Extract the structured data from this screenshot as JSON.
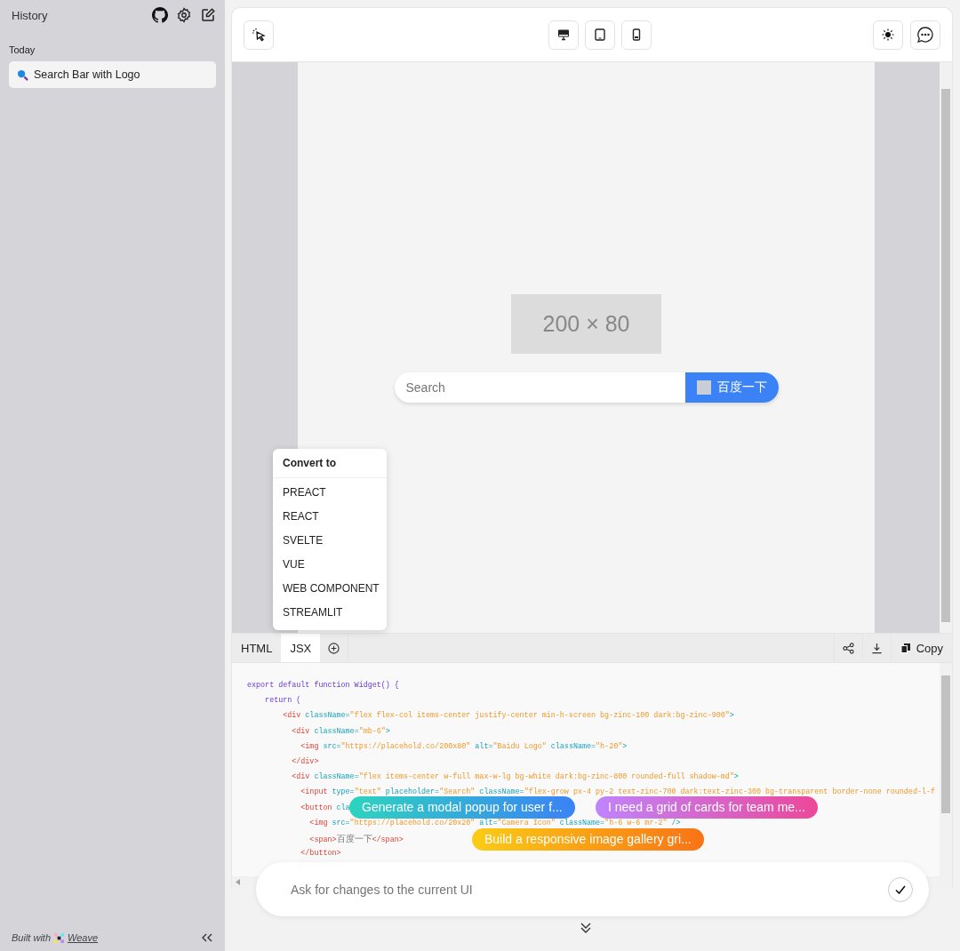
{
  "sidebar": {
    "title": "History",
    "section": "Today",
    "items": [
      {
        "label": "Search Bar with Logo",
        "selected": true
      }
    ],
    "footer": {
      "prefix": "Built with",
      "link": "Weave"
    }
  },
  "preview": {
    "logo": "200 × 80",
    "search_placeholder": "Search",
    "search_button": "百度一下"
  },
  "convert_menu": {
    "title": "Convert to",
    "options": [
      "PREACT",
      "REACT",
      "SVELTE",
      "VUE",
      "WEB COMPONENT",
      "STREAMLIT"
    ]
  },
  "code_tabs": [
    {
      "label": "HTML",
      "selected": false
    },
    {
      "label": "JSX",
      "selected": true
    }
  ],
  "copy_button": "Copy",
  "code_lines": [
    [
      {
        "kind": "kw",
        "text": "export default function Widget() {"
      }
    ],
    [
      {
        "kind": "kw",
        "text": "    return ("
      }
    ],
    [
      {
        "kind": "tag",
        "text": "        <div"
      },
      {
        "kind": "attr",
        "text": " className="
      },
      {
        "kind": "str",
        "text": "\"flex flex-col items-center justify-center min-h-screen bg-zinc-100 dark:bg-zinc-900\""
      },
      {
        "kind": "attr",
        "text": ">"
      }
    ],
    [
      {
        "kind": "tag",
        "text": "          <div"
      },
      {
        "kind": "attr",
        "text": " className="
      },
      {
        "kind": "str",
        "text": "\"mb-6\""
      },
      {
        "kind": "attr",
        "text": ">"
      }
    ],
    [
      {
        "kind": "tag",
        "text": "            <img"
      },
      {
        "kind": "attr",
        "text": " src="
      },
      {
        "kind": "str",
        "text": "\"https://placehold.co/200x80\""
      },
      {
        "kind": "attr",
        "text": " alt="
      },
      {
        "kind": "str",
        "text": "\"Baidu Logo\""
      },
      {
        "kind": "attr",
        "text": " className="
      },
      {
        "kind": "str",
        "text": "\"h-20\""
      },
      {
        "kind": "attr",
        "text": ">"
      }
    ],
    [
      {
        "kind": "tag",
        "text": "          </div>"
      }
    ],
    [
      {
        "kind": "tag",
        "text": "          <div"
      },
      {
        "kind": "attr",
        "text": " className="
      },
      {
        "kind": "str",
        "text": "\"flex items-center w-full max-w-lg bg-white dark:bg-zinc-800 rounded-full shadow-md\""
      },
      {
        "kind": "attr",
        "text": ">"
      }
    ],
    [
      {
        "kind": "tag",
        "text": "            <input"
      },
      {
        "kind": "attr",
        "text": " type="
      },
      {
        "kind": "str",
        "text": "\"text\""
      },
      {
        "kind": "attr",
        "text": " placeholder="
      },
      {
        "kind": "str",
        "text": "\"Search\""
      },
      {
        "kind": "attr",
        "text": " className="
      },
      {
        "kind": "str",
        "text": "\"flex-grow px-4 py-2 text-zinc-700 dark:text-zinc-300 bg-transparent border-none rounded-l-f"
      }
    ],
    [
      {
        "kind": "tag",
        "text": "            <button"
      },
      {
        "kind": "attr",
        "text": " cla"
      }
    ],
    [
      {
        "kind": "tag",
        "text": "              <img"
      },
      {
        "kind": "attr",
        "text": " src="
      },
      {
        "kind": "str",
        "text": "\"https://placehold.co/20x20\""
      },
      {
        "kind": "attr",
        "text": " alt="
      },
      {
        "kind": "str",
        "text": "\"Camera Icon\""
      },
      {
        "kind": "attr",
        "text": " className="
      },
      {
        "kind": "str",
        "text": "\"h-6 w-6 mr-2\""
      },
      {
        "kind": "attr",
        "text": " />"
      }
    ],
    [
      {
        "kind": "tag",
        "text": "              <span>"
      },
      {
        "kind": "text",
        "text": "百度一下"
      },
      {
        "kind": "tag",
        "text": "</span>"
      }
    ],
    [
      {
        "kind": "tag",
        "text": "            </button>"
      }
    ]
  ],
  "suggestions": [
    {
      "label": "Generate a modal popup for user f...",
      "kind": "cool"
    },
    {
      "label": "I need a grid of cards for team me...",
      "kind": "pink"
    },
    {
      "label": "Build a responsive image gallery gri...",
      "kind": "warm"
    }
  ],
  "prompt": {
    "placeholder": "Ask for changes to the current UI"
  }
}
